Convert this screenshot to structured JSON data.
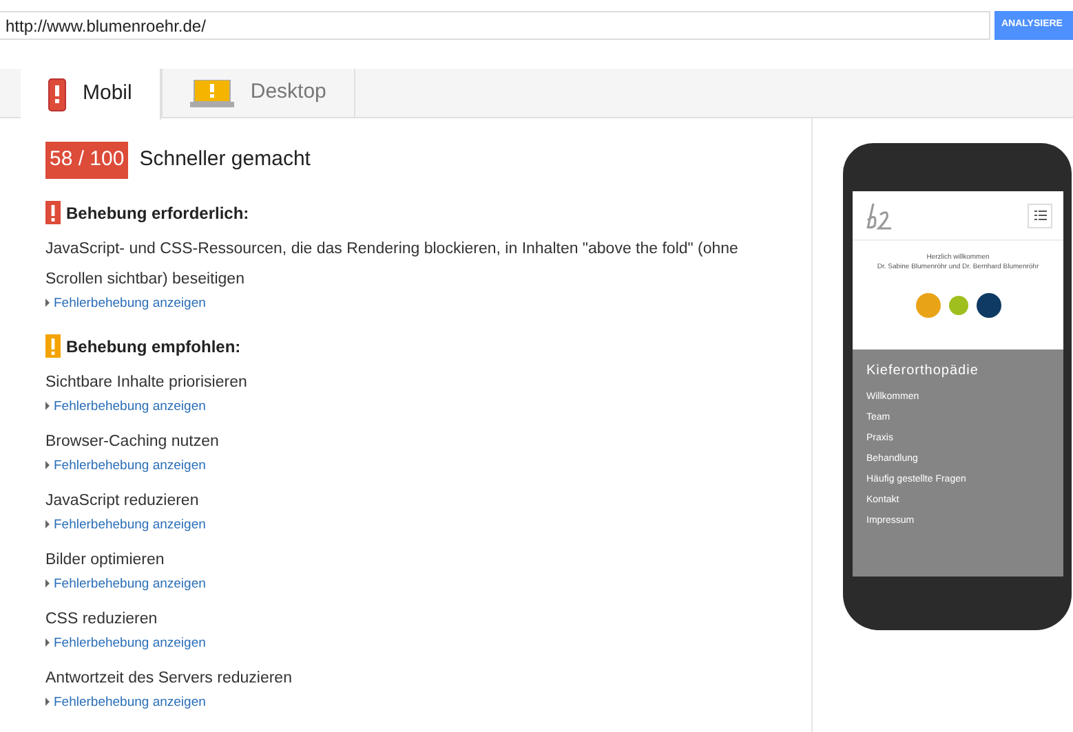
{
  "url_field": {
    "value": "http://www.blumenroehr.de/"
  },
  "analyze_button": "ANALYSIERE",
  "tabs": [
    {
      "label": "Mobil",
      "kind": "phone",
      "selected": true
    },
    {
      "label": "Desktop",
      "kind": "monitor",
      "selected": false
    }
  ],
  "score": {
    "value": "58 / 100",
    "title": "Schneller gemacht"
  },
  "sections": [
    {
      "kind": "error",
      "heading": "Behebung erforderlich:",
      "items": [
        {
          "text": "JavaScript- und CSS-Ressourcen, die das Rendering blockieren, in Inhalten \"above the fold\" (ohne Scrollen sichtbar) beseitigen",
          "link": "Fehlerbehebung anzeigen"
        }
      ]
    },
    {
      "kind": "warning",
      "heading": "Behebung empfohlen:",
      "items": [
        {
          "text": "Sichtbare Inhalte priorisieren",
          "link": "Fehlerbehebung anzeigen"
        },
        {
          "text": "Browser-Caching nutzen",
          "link": "Fehlerbehebung anzeigen"
        },
        {
          "text": "JavaScript reduzieren",
          "link": "Fehlerbehebung anzeigen"
        },
        {
          "text": "Bilder optimieren",
          "link": "Fehlerbehebung anzeigen"
        },
        {
          "text": "CSS reduzieren",
          "link": "Fehlerbehebung anzeigen"
        },
        {
          "text": "Antwortzeit des Servers reduzieren",
          "link": "Fehlerbehebung anzeigen"
        }
      ]
    }
  ],
  "phone_preview": {
    "welcome": "Herzlich willkommen",
    "names": "Dr. Sabine Blumenröhr und Dr. Bernhard Blumenröhr",
    "menu_title": "Kieferorthopädie",
    "menu_items": [
      "Willkommen",
      "Team",
      "Praxis",
      "Behandlung",
      "Häufig gestellte Fragen",
      "Kontakt",
      "Impressum"
    ]
  }
}
